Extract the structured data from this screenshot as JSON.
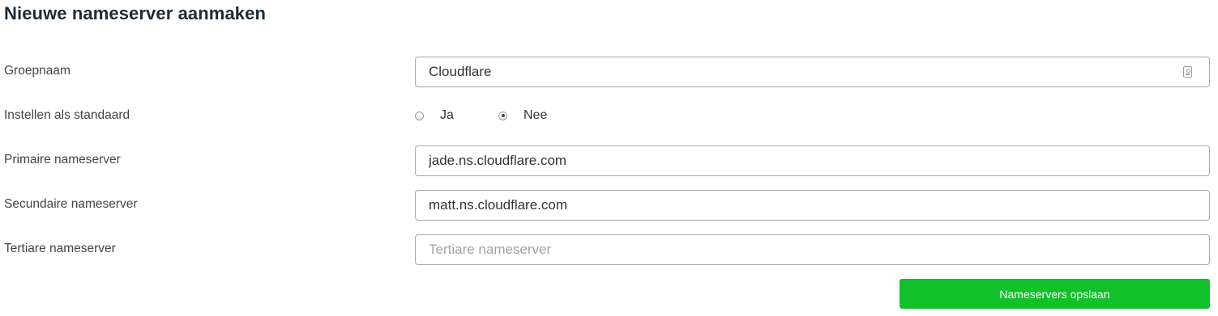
{
  "page": {
    "title": "Nieuwe nameserver aanmaken"
  },
  "form": {
    "group_name": {
      "label": "Groepnaam",
      "value": "Cloudflare",
      "icon": "contact-card-icon"
    },
    "set_default": {
      "label": "Instellen als standaard",
      "options": [
        {
          "label": "Ja",
          "checked": false
        },
        {
          "label": "Nee",
          "checked": true
        }
      ]
    },
    "primary": {
      "label": "Primaire nameserver",
      "value": "jade.ns.cloudflare.com"
    },
    "secondary": {
      "label": "Secundaire nameserver",
      "value": "matt.ns.cloudflare.com"
    },
    "tertiary": {
      "label": "Tertiare nameserver",
      "value": "",
      "placeholder": "Tertiare nameserver"
    },
    "submit": {
      "label": "Nameservers opslaan",
      "color": "#12c02a"
    }
  }
}
